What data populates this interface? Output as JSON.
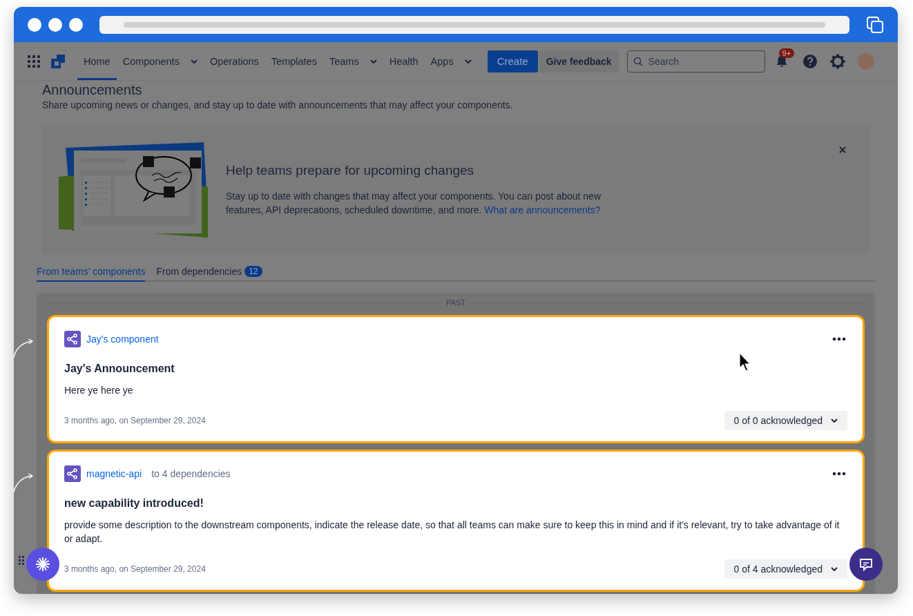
{
  "nav": {
    "items": [
      {
        "label": "Home",
        "selected": true,
        "dropdown": false
      },
      {
        "label": "Components",
        "selected": false,
        "dropdown": true
      },
      {
        "label": "Operations",
        "selected": false,
        "dropdown": false
      },
      {
        "label": "Templates",
        "selected": false,
        "dropdown": false
      },
      {
        "label": "Teams",
        "selected": false,
        "dropdown": true
      },
      {
        "label": "Health",
        "selected": false,
        "dropdown": false
      },
      {
        "label": "Apps",
        "selected": false,
        "dropdown": true
      }
    ],
    "create_button": "Create",
    "feedback_button": "Give feedback",
    "search": {
      "placeholder": "Search"
    },
    "notification_badge": "9+"
  },
  "page": {
    "title": "Announcements",
    "subtitle": "Share upcoming news or changes, and stay up to date with announcements that may affect your components."
  },
  "banner": {
    "title": "Help teams prepare for upcoming changes",
    "text": "Stay up to date with changes that may affect your components. You can post about new features, API deprecations, scheduled downtime, and more.",
    "link": "What are announcements?"
  },
  "tabs": [
    {
      "label": "From teams’ components",
      "selected": true
    },
    {
      "label": "From dependencies",
      "selected": false,
      "count": "12"
    }
  ],
  "section_label": "PAST",
  "announcements": [
    {
      "component": "Jay's component",
      "title": "Jay's Announcement",
      "body": "Here ye here ye",
      "date": "3 months ago, on September 29, 2024",
      "acknowledged": "0 of 0 acknowledged"
    },
    {
      "component": "magnetic-api",
      "target": "to 4 dependencies",
      "title": "new capability introduced!",
      "body": "provide some description to the downstream components, indicate the release date, so that all teams can make sure to keep this in mind and if it's relevant, try to take advantage of it or adapt.",
      "date": "3 months ago, on September 29, 2024",
      "acknowledged": "0 of 4 acknowledged"
    }
  ]
}
